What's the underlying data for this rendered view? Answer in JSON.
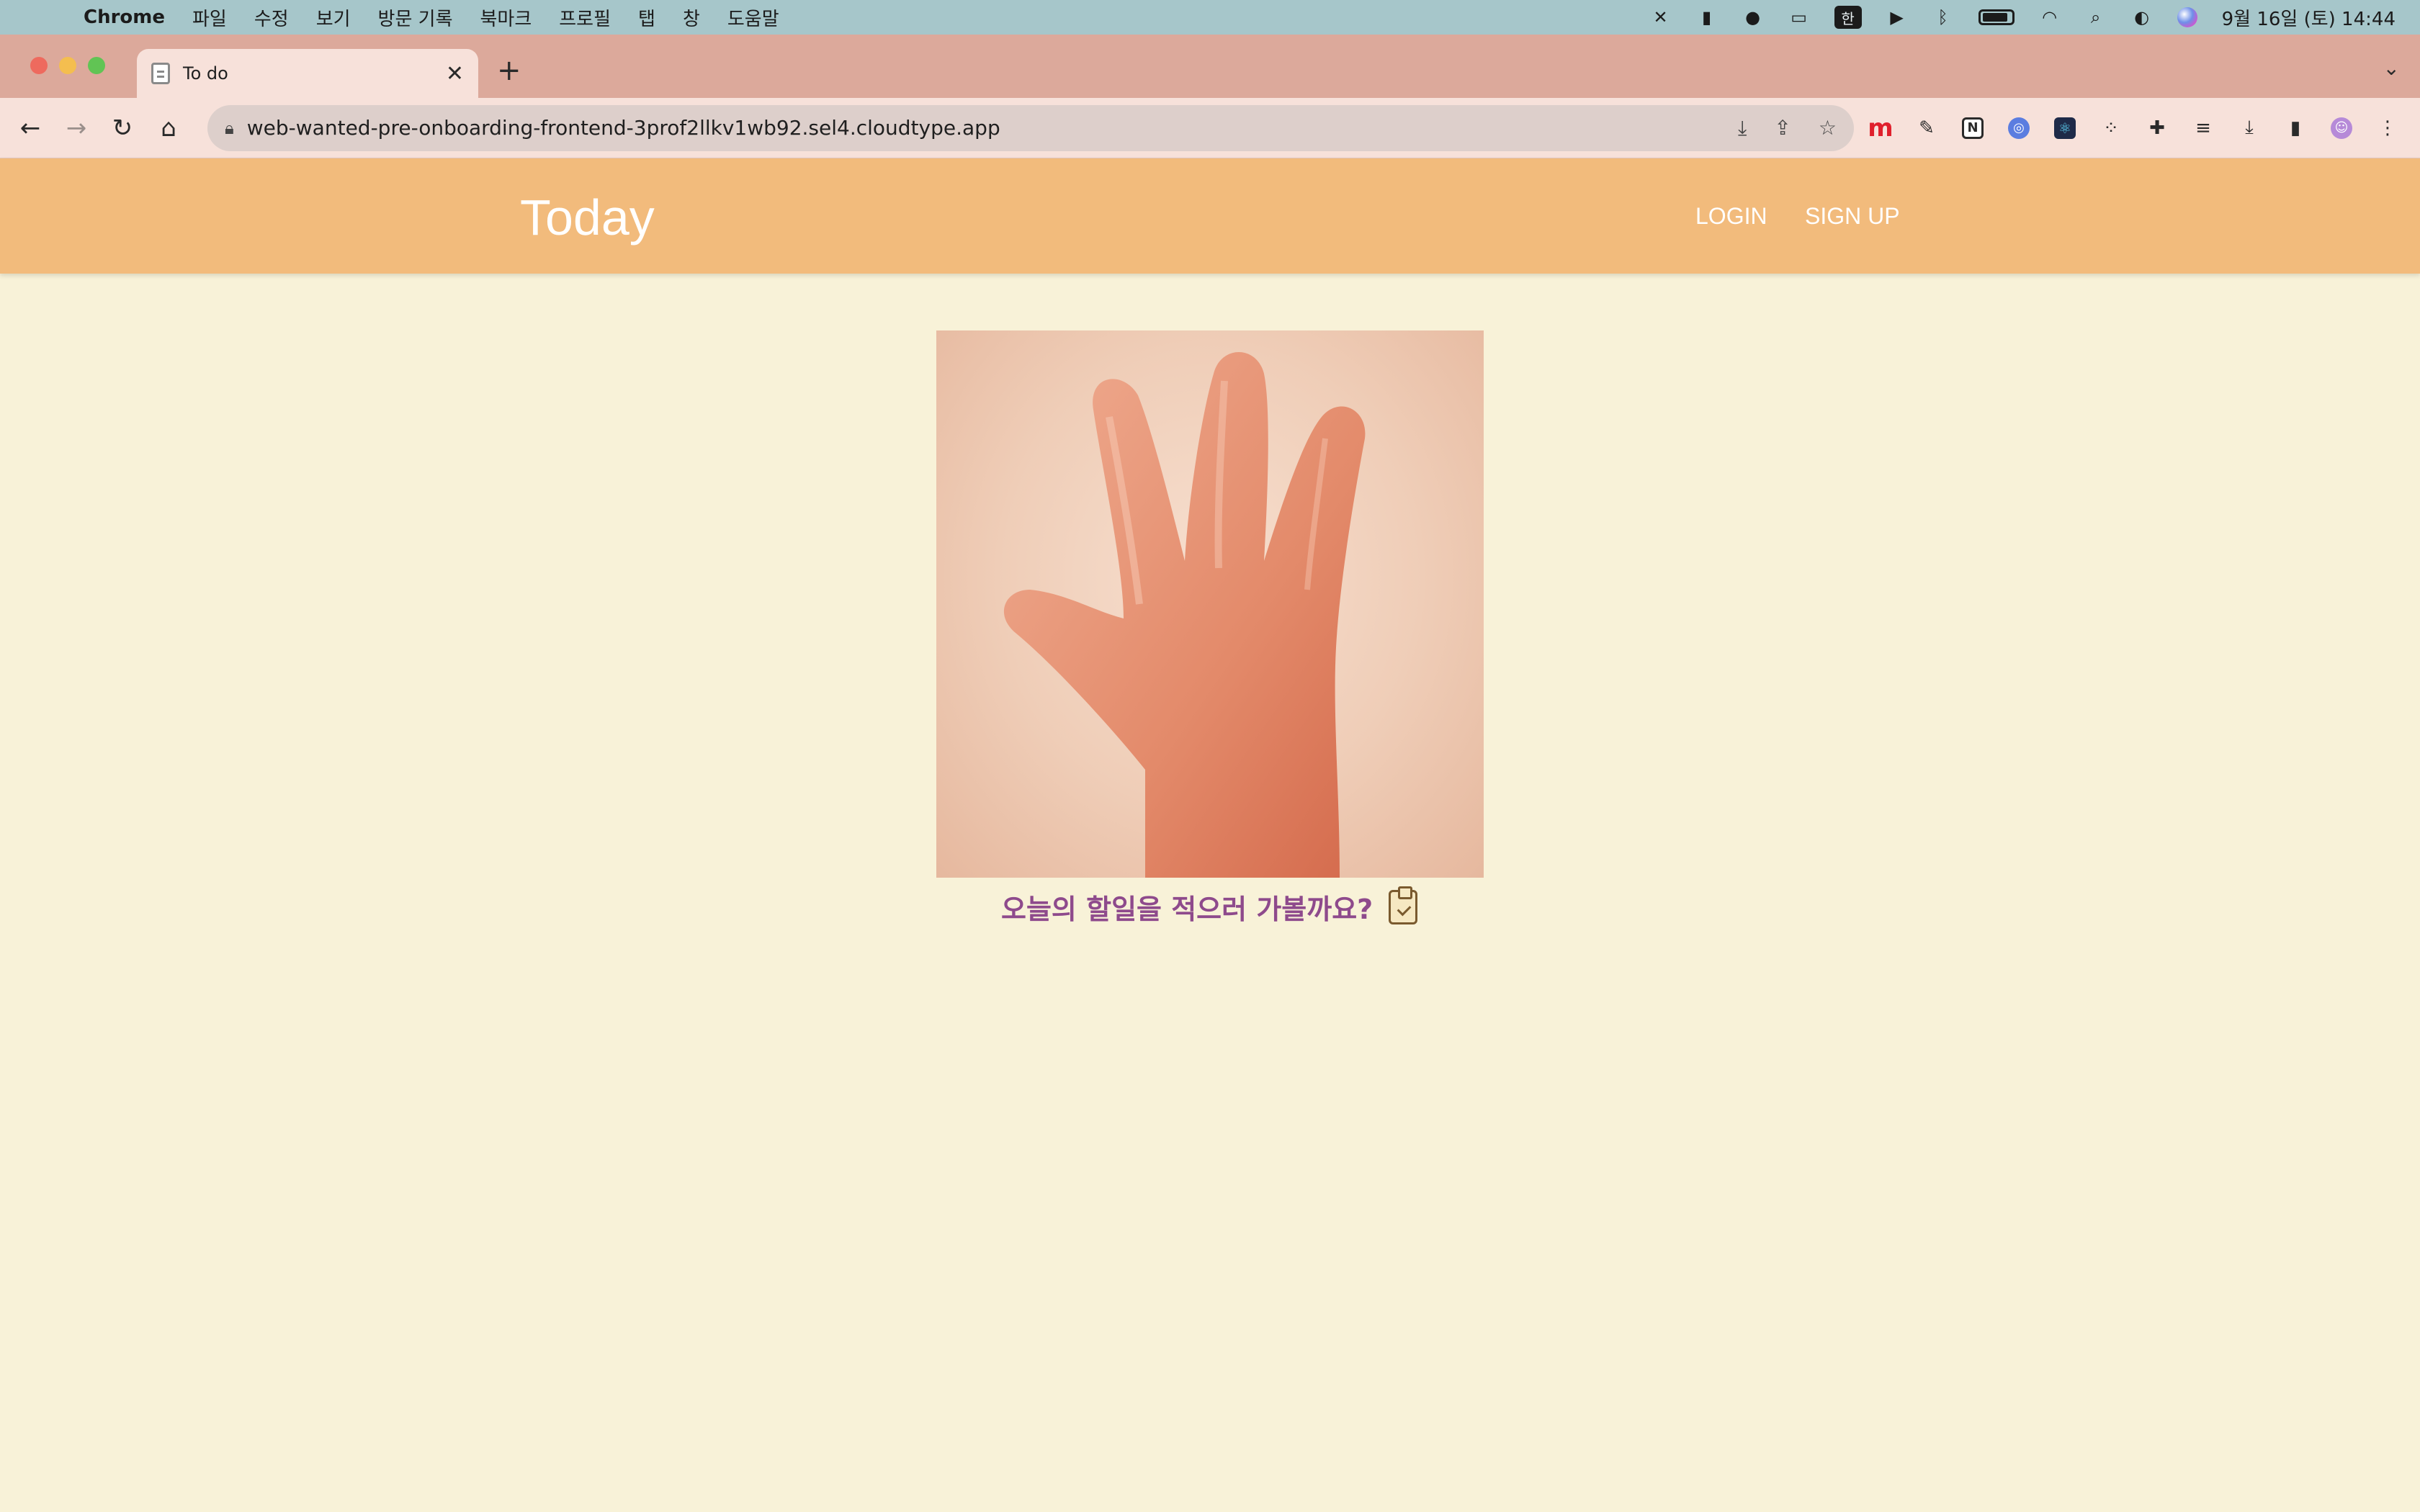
{
  "menubar": {
    "app_name": "Chrome",
    "items": [
      "파일",
      "수정",
      "보기",
      "방문 기록",
      "북마크",
      "프로필",
      "탭",
      "창",
      "도움말"
    ],
    "ime_label": "한",
    "clock": "9월 16일 (토) 14:44"
  },
  "browser": {
    "tab_title": "To do",
    "url": "web-wanted-pre-onboarding-frontend-3prof2llkv1wb92.sel4.cloudtype.app"
  },
  "app": {
    "logo": "Today",
    "nav": {
      "login": "LOGIN",
      "signup": "SIGN UP"
    },
    "hero_text": "오늘의 할일을 적으러 가볼까요?"
  },
  "colors": {
    "header_bg": "#f2bb7c",
    "page_bg": "#f8f2d8",
    "hero_text": "#8e4a8c",
    "tab_strip": "#dca99b"
  }
}
